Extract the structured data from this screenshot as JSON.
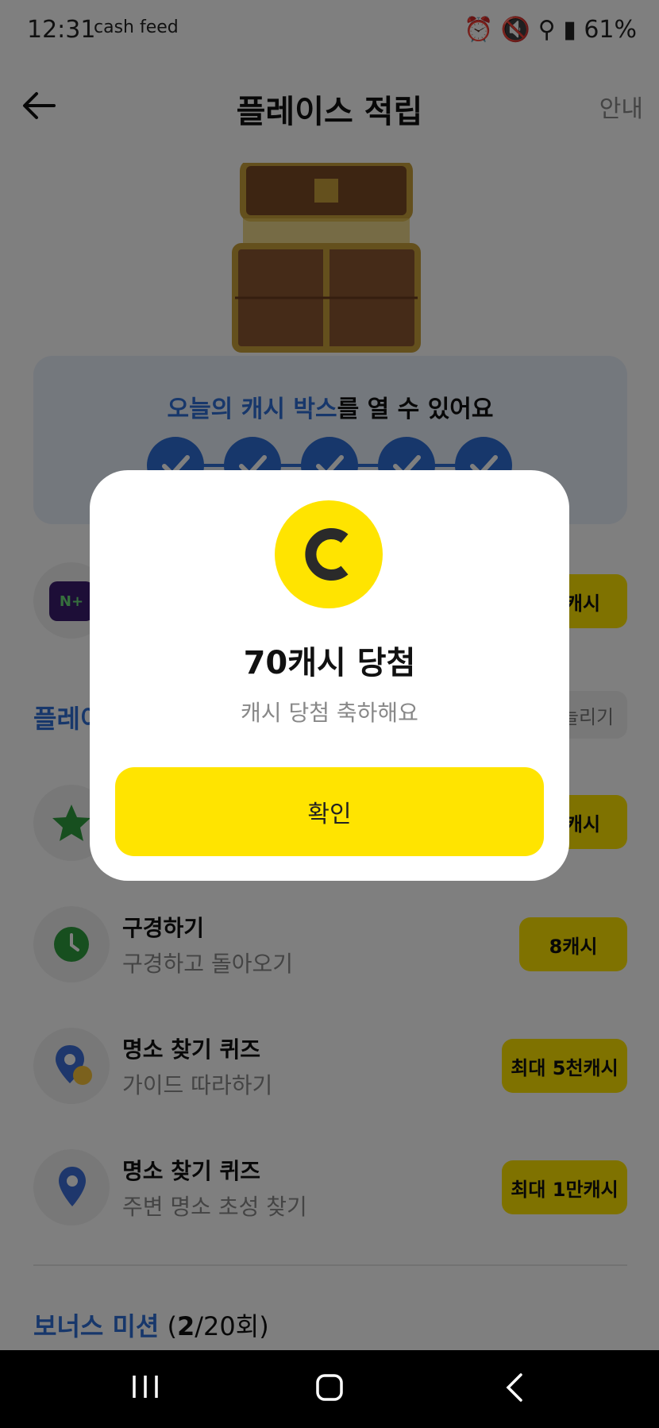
{
  "status_bar": {
    "time": "12:31",
    "app_icons": "cash feed",
    "battery": "61%"
  },
  "header": {
    "title": "플레이스 적립",
    "guide_label": "안내"
  },
  "today_box": {
    "highlight": "오늘의 캐시 박스",
    "text": "를 열 수 있어요",
    "checks_done": 5
  },
  "ad_row": {
    "reward": "캐시"
  },
  "place_section": {
    "title": "플레이",
    "more_label": "늘리기"
  },
  "missions": [
    {
      "title": "",
      "subtitle": "",
      "reward": "캐시"
    },
    {
      "title": "구경하기",
      "subtitle": "구경하고 돌아오기",
      "reward": "8캐시"
    },
    {
      "title": "명소 찾기 퀴즈",
      "subtitle": "가이드 따라하기",
      "reward": "최대 5천캐시"
    },
    {
      "title": "명소 찾기 퀴즈",
      "subtitle": "주변 명소 초성 찾기",
      "reward": "최대 1만캐시"
    }
  ],
  "bonus": {
    "title": "보너스 미션",
    "count_open": " (",
    "done": "2",
    "count_rest": "/20회)"
  },
  "modal": {
    "title": "70캐시 당첨",
    "subtitle": "캐시 당첨 축하해요",
    "confirm_label": "확인"
  },
  "colors": {
    "accent": "#ffe400",
    "blue": "#2f6fd6"
  }
}
